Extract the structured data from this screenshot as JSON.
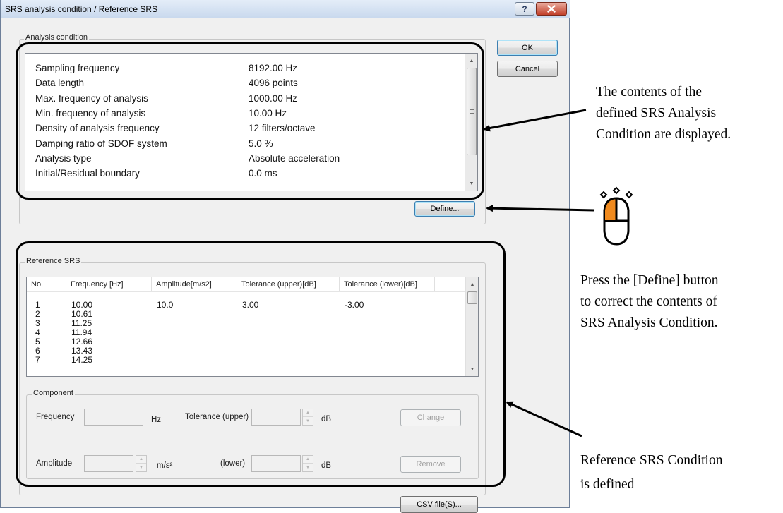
{
  "window": {
    "title": "SRS analysis condition / Reference SRS",
    "help_label": "?",
    "close_label": "x"
  },
  "analysis": {
    "group_label": "Analysis condition",
    "rows": [
      {
        "label": "Sampling frequency",
        "value": "8192.00 Hz"
      },
      {
        "label": "Data length",
        "value": "4096 points"
      },
      {
        "label": "Max. frequency of analysis",
        "value": "1000.00 Hz"
      },
      {
        "label": "Min. frequency of analysis",
        "value": "10.00 Hz"
      },
      {
        "label": "Density of analysis frequency",
        "value": "12 filters/octave"
      },
      {
        "label": "Damping ratio of SDOF system",
        "value": "5.0 %"
      },
      {
        "label": "Analysis type",
        "value": "Absolute acceleration"
      },
      {
        "label": "Initial/Residual boundary",
        "value": "0.0 ms"
      }
    ],
    "define_label": "Define..."
  },
  "buttons": {
    "ok": "OK",
    "cancel": "Cancel",
    "csv": "CSV file(S)..."
  },
  "reference": {
    "group_label": "Reference SRS",
    "columns": [
      "No.",
      "Frequency [Hz]",
      "Amplitude[m/s2]",
      "Tolerance (upper)[dB]",
      "Tolerance (lower)[dB]"
    ],
    "rows": [
      {
        "no": "1",
        "freq": "10.00",
        "amp": "10.0",
        "upper": "3.00",
        "lower": "-3.00"
      },
      {
        "no": "2",
        "freq": "10.61",
        "amp": "",
        "upper": "",
        "lower": ""
      },
      {
        "no": "3",
        "freq": "11.25",
        "amp": "",
        "upper": "",
        "lower": ""
      },
      {
        "no": "4",
        "freq": "11.94",
        "amp": "",
        "upper": "",
        "lower": ""
      },
      {
        "no": "5",
        "freq": "12.66",
        "amp": "",
        "upper": "",
        "lower": ""
      },
      {
        "no": "6",
        "freq": "13.43",
        "amp": "",
        "upper": "",
        "lower": ""
      },
      {
        "no": "7",
        "freq": "14.25",
        "amp": "",
        "upper": "",
        "lower": ""
      }
    ]
  },
  "component": {
    "group_label": "Component",
    "frequency_label": "Frequency",
    "frequency_value": "",
    "hz_unit": "Hz",
    "tol_upper_label": "Tolerance (upper)",
    "tol_upper_value": "",
    "db_unit": "dB",
    "amplitude_label": "Amplitude",
    "amplitude_value": "",
    "ms2_unit": "m/s²",
    "lower_label": "(lower)",
    "tol_lower_value": "",
    "change_label": "Change",
    "remove_label": "Remove"
  },
  "annotations": {
    "analysis_note": [
      "The contents of the",
      "defined SRS Analysis",
      "Condition are displayed."
    ],
    "define_note": [
      "Press the [Define] button",
      "to correct the contents of",
      "SRS Analysis Condition."
    ],
    "reference_note": [
      "Reference SRS Condition",
      "is defined"
    ]
  },
  "colors": {
    "mouse_button": "#f08a1e",
    "title_bar": "#c9d9ee",
    "close_button": "#c2412b"
  }
}
